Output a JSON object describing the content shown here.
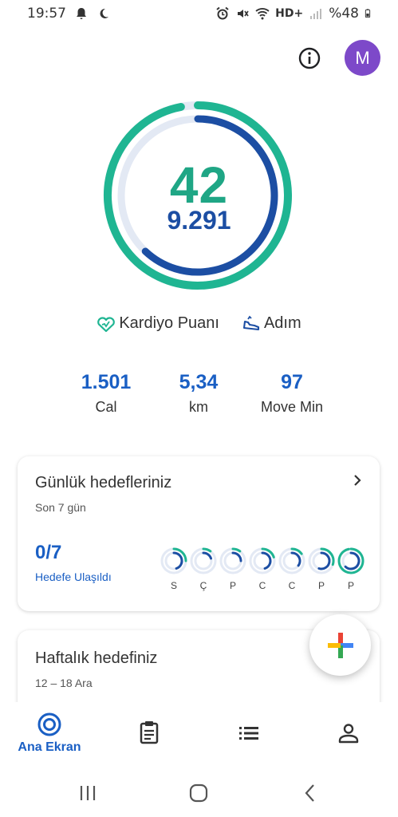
{
  "status_bar": {
    "time": "19:57",
    "network": "HD+",
    "battery": "%48"
  },
  "header": {
    "avatar_letter": "M"
  },
  "ring": {
    "primary_value": "42",
    "secondary_value": "9.291",
    "cardio_progress": 0.97,
    "steps_progress": 0.62
  },
  "legend": {
    "cardio_label": "Kardiyo Puanı",
    "steps_label": "Adım"
  },
  "stats": [
    {
      "value": "1.501",
      "label": "Cal"
    },
    {
      "value": "5,34",
      "label": "km"
    },
    {
      "value": "97",
      "label": "Move Min"
    }
  ],
  "daily_goals": {
    "title": "Günlük hedefleriniz",
    "subtitle": "Son 7 gün",
    "count": "0/7",
    "count_label": "Hedefe Ulaşıldı",
    "days": [
      {
        "label": "S",
        "cardio": 0.25,
        "steps": 0.45
      },
      {
        "label": "Ç",
        "cardio": 0.1,
        "steps": 0.2
      },
      {
        "label": "P",
        "cardio": 0.1,
        "steps": 0.25
      },
      {
        "label": "C",
        "cardio": 0.2,
        "steps": 0.45
      },
      {
        "label": "C",
        "cardio": 0.15,
        "steps": 0.35
      },
      {
        "label": "P",
        "cardio": 0.3,
        "steps": 0.55
      },
      {
        "label": "P",
        "cardio": 0.97,
        "steps": 0.62
      }
    ]
  },
  "weekly_goal": {
    "title": "Haftalık hedefiniz",
    "subtitle": "12 – 18 Ara"
  },
  "bottom_nav": {
    "home_label": "Ana Ekran"
  },
  "colors": {
    "cardio": "#1fb592",
    "steps": "#1c4ea3",
    "track": "#e3e9f4",
    "accent": "#1a5fc4"
  }
}
